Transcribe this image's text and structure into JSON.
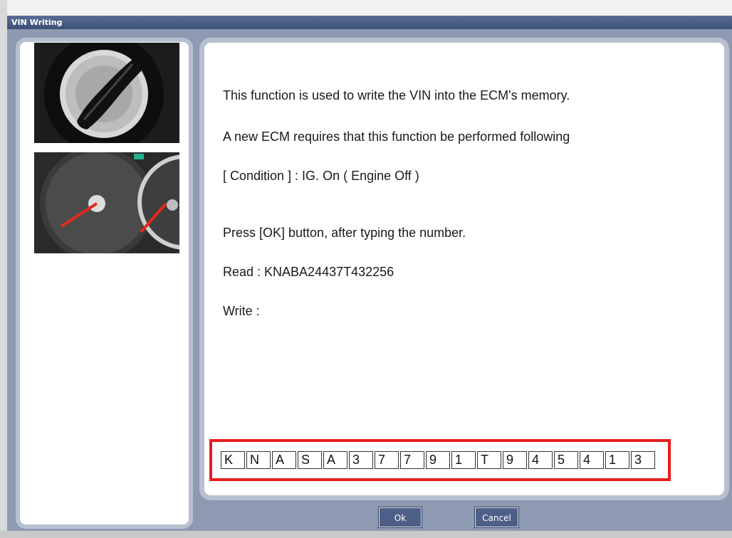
{
  "window": {
    "title": "VIN Writing"
  },
  "text": {
    "line1": "This function is used to write the VIN into the ECM's memory.",
    "line2": "A new ECM requires that this function be performed following",
    "line3": "[ Condition ] : IG. On ( Engine Off )",
    "line4": "Press [OK] button, after typing the number.",
    "line5": "Read : KNABA24437T432256",
    "line6": "Write :"
  },
  "vin": [
    "K",
    "N",
    "A",
    "S",
    "A",
    "3",
    "7",
    "7",
    "9",
    "1",
    "T",
    "9",
    "4",
    "5",
    "4",
    "1",
    "3"
  ],
  "buttons": {
    "ok": "Ok",
    "cancel": "Cancel"
  },
  "colors": {
    "highlight": "#e51e1e",
    "button": "#4d5f86"
  }
}
